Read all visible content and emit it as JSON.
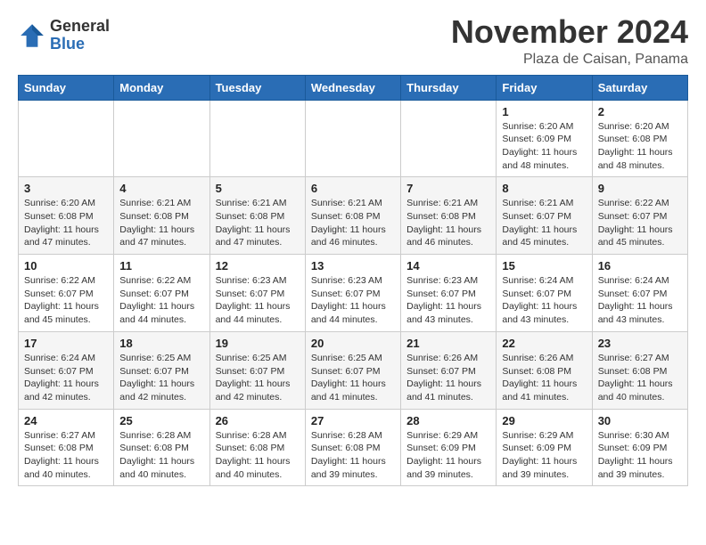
{
  "header": {
    "logo_general": "General",
    "logo_blue": "Blue",
    "month_title": "November 2024",
    "location": "Plaza de Caisan, Panama"
  },
  "weekdays": [
    "Sunday",
    "Monday",
    "Tuesday",
    "Wednesday",
    "Thursday",
    "Friday",
    "Saturday"
  ],
  "rows": [
    [
      {
        "day": "",
        "info": ""
      },
      {
        "day": "",
        "info": ""
      },
      {
        "day": "",
        "info": ""
      },
      {
        "day": "",
        "info": ""
      },
      {
        "day": "",
        "info": ""
      },
      {
        "day": "1",
        "info": "Sunrise: 6:20 AM\nSunset: 6:09 PM\nDaylight: 11 hours and 48 minutes."
      },
      {
        "day": "2",
        "info": "Sunrise: 6:20 AM\nSunset: 6:08 PM\nDaylight: 11 hours and 48 minutes."
      }
    ],
    [
      {
        "day": "3",
        "info": "Sunrise: 6:20 AM\nSunset: 6:08 PM\nDaylight: 11 hours and 47 minutes."
      },
      {
        "day": "4",
        "info": "Sunrise: 6:21 AM\nSunset: 6:08 PM\nDaylight: 11 hours and 47 minutes."
      },
      {
        "day": "5",
        "info": "Sunrise: 6:21 AM\nSunset: 6:08 PM\nDaylight: 11 hours and 47 minutes."
      },
      {
        "day": "6",
        "info": "Sunrise: 6:21 AM\nSunset: 6:08 PM\nDaylight: 11 hours and 46 minutes."
      },
      {
        "day": "7",
        "info": "Sunrise: 6:21 AM\nSunset: 6:08 PM\nDaylight: 11 hours and 46 minutes."
      },
      {
        "day": "8",
        "info": "Sunrise: 6:21 AM\nSunset: 6:07 PM\nDaylight: 11 hours and 45 minutes."
      },
      {
        "day": "9",
        "info": "Sunrise: 6:22 AM\nSunset: 6:07 PM\nDaylight: 11 hours and 45 minutes."
      }
    ],
    [
      {
        "day": "10",
        "info": "Sunrise: 6:22 AM\nSunset: 6:07 PM\nDaylight: 11 hours and 45 minutes."
      },
      {
        "day": "11",
        "info": "Sunrise: 6:22 AM\nSunset: 6:07 PM\nDaylight: 11 hours and 44 minutes."
      },
      {
        "day": "12",
        "info": "Sunrise: 6:23 AM\nSunset: 6:07 PM\nDaylight: 11 hours and 44 minutes."
      },
      {
        "day": "13",
        "info": "Sunrise: 6:23 AM\nSunset: 6:07 PM\nDaylight: 11 hours and 44 minutes."
      },
      {
        "day": "14",
        "info": "Sunrise: 6:23 AM\nSunset: 6:07 PM\nDaylight: 11 hours and 43 minutes."
      },
      {
        "day": "15",
        "info": "Sunrise: 6:24 AM\nSunset: 6:07 PM\nDaylight: 11 hours and 43 minutes."
      },
      {
        "day": "16",
        "info": "Sunrise: 6:24 AM\nSunset: 6:07 PM\nDaylight: 11 hours and 43 minutes."
      }
    ],
    [
      {
        "day": "17",
        "info": "Sunrise: 6:24 AM\nSunset: 6:07 PM\nDaylight: 11 hours and 42 minutes."
      },
      {
        "day": "18",
        "info": "Sunrise: 6:25 AM\nSunset: 6:07 PM\nDaylight: 11 hours and 42 minutes."
      },
      {
        "day": "19",
        "info": "Sunrise: 6:25 AM\nSunset: 6:07 PM\nDaylight: 11 hours and 42 minutes."
      },
      {
        "day": "20",
        "info": "Sunrise: 6:25 AM\nSunset: 6:07 PM\nDaylight: 11 hours and 41 minutes."
      },
      {
        "day": "21",
        "info": "Sunrise: 6:26 AM\nSunset: 6:07 PM\nDaylight: 11 hours and 41 minutes."
      },
      {
        "day": "22",
        "info": "Sunrise: 6:26 AM\nSunset: 6:08 PM\nDaylight: 11 hours and 41 minutes."
      },
      {
        "day": "23",
        "info": "Sunrise: 6:27 AM\nSunset: 6:08 PM\nDaylight: 11 hours and 40 minutes."
      }
    ],
    [
      {
        "day": "24",
        "info": "Sunrise: 6:27 AM\nSunset: 6:08 PM\nDaylight: 11 hours and 40 minutes."
      },
      {
        "day": "25",
        "info": "Sunrise: 6:28 AM\nSunset: 6:08 PM\nDaylight: 11 hours and 40 minutes."
      },
      {
        "day": "26",
        "info": "Sunrise: 6:28 AM\nSunset: 6:08 PM\nDaylight: 11 hours and 40 minutes."
      },
      {
        "day": "27",
        "info": "Sunrise: 6:28 AM\nSunset: 6:08 PM\nDaylight: 11 hours and 39 minutes."
      },
      {
        "day": "28",
        "info": "Sunrise: 6:29 AM\nSunset: 6:09 PM\nDaylight: 11 hours and 39 minutes."
      },
      {
        "day": "29",
        "info": "Sunrise: 6:29 AM\nSunset: 6:09 PM\nDaylight: 11 hours and 39 minutes."
      },
      {
        "day": "30",
        "info": "Sunrise: 6:30 AM\nSunset: 6:09 PM\nDaylight: 11 hours and 39 minutes."
      }
    ]
  ]
}
